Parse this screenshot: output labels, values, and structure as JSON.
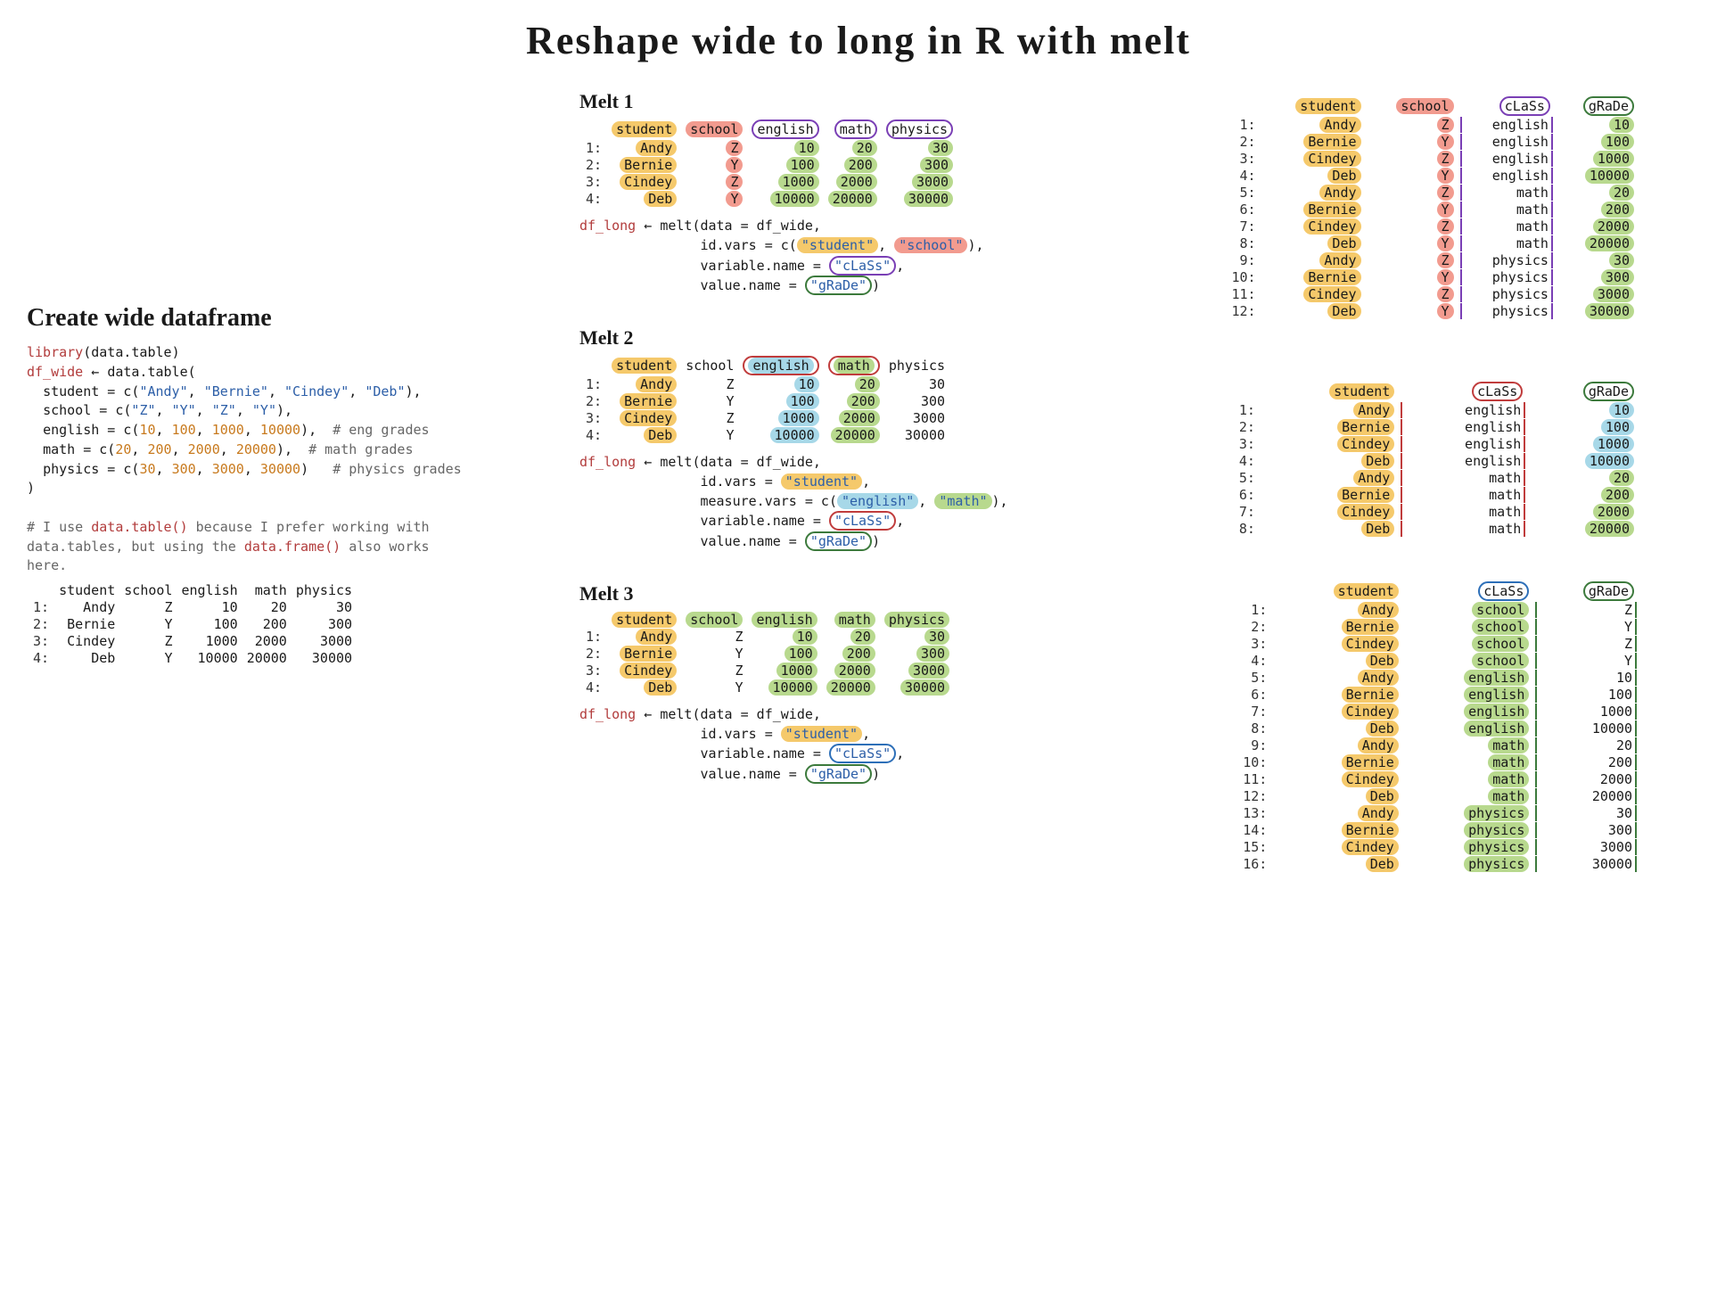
{
  "title": "Reshape wide to long in R with melt",
  "create": {
    "heading": "Create wide dataframe",
    "lib_call": "library",
    "lib_arg": "data.table",
    "df_var": "df_wide",
    "dt_fn": "data.table",
    "cols": {
      "student": "student",
      "school": "school",
      "english": "english",
      "math": "math",
      "physics": "physics"
    },
    "students": [
      "Andy",
      "Bernie",
      "Cindey",
      "Deb"
    ],
    "schools": [
      "Z",
      "Y",
      "Z",
      "Y"
    ],
    "english_vals": [
      10,
      100,
      1000,
      10000
    ],
    "math_vals": [
      20,
      200,
      2000,
      20000
    ],
    "physics_vals": [
      30,
      300,
      3000,
      30000
    ],
    "eng_comment": "# eng grades",
    "math_comment": "# math grades",
    "phys_comment": "# physics grades",
    "footnote_line1": "# I use",
    "footnote_dt": "data.table()",
    "footnote_line1b": " because I prefer working with",
    "footnote_line2": "data.tables, but using the ",
    "footnote_df": "data.frame()",
    "footnote_line2b": " also works",
    "footnote_line3": "here."
  },
  "melt1": {
    "heading": "Melt 1",
    "call_var": "df_long",
    "fn": "melt",
    "data_arg": "data = df_wide,",
    "id_vars_label": "id.vars = c(",
    "id_vars_v1": "\"student\"",
    "id_vars_v2": "\"school\"",
    "variable_name_label": "variable.name = ",
    "variable_name_val": "\"cLaSs\"",
    "value_name_label": "value.name = ",
    "value_name_val": "\"gRaDe\""
  },
  "melt2": {
    "heading": "Melt 2",
    "call_var": "df_long",
    "fn": "melt",
    "data_arg": "data = df_wide,",
    "id_vars_label": "id.vars = ",
    "id_vars_v1": "\"student\"",
    "measure_vars_label": "measure.vars = c(",
    "measure_v1": "\"english\"",
    "measure_v2": "\"math\"",
    "variable_name_label": "variable.name = ",
    "variable_name_val": "\"cLaSs\"",
    "value_name_label": "value.name = ",
    "value_name_val": "\"gRaDe\""
  },
  "melt3": {
    "heading": "Melt 3",
    "call_var": "df_long",
    "fn": "melt",
    "data_arg": "data = df_wide,",
    "id_vars_label": "id.vars = ",
    "id_vars_v1": "\"student\"",
    "variable_name_label": "variable.name = ",
    "variable_name_val": "\"cLaSs\"",
    "value_name_label": "value.name = ",
    "value_name_val": "\"gRaDe\""
  },
  "wide_header": [
    "student",
    "school",
    "english",
    "math",
    "physics"
  ],
  "wide_rows": [
    {
      "idx": "1:",
      "student": "Andy",
      "school": "Z",
      "english": 10,
      "math": 20,
      "physics": 30
    },
    {
      "idx": "2:",
      "student": "Bernie",
      "school": "Y",
      "english": 100,
      "math": 200,
      "physics": 300
    },
    {
      "idx": "3:",
      "student": "Cindey",
      "school": "Z",
      "english": 1000,
      "math": 2000,
      "physics": 3000
    },
    {
      "idx": "4:",
      "student": "Deb",
      "school": "Y",
      "english": 10000,
      "math": 20000,
      "physics": 30000
    }
  ],
  "result1_header": [
    "student",
    "school",
    "cLaSs",
    "gRaDe"
  ],
  "result1_rows": [
    {
      "idx": "1:",
      "student": "Andy",
      "school": "Z",
      "class": "english",
      "grade": 10
    },
    {
      "idx": "2:",
      "student": "Bernie",
      "school": "Y",
      "class": "english",
      "grade": 100
    },
    {
      "idx": "3:",
      "student": "Cindey",
      "school": "Z",
      "class": "english",
      "grade": 1000
    },
    {
      "idx": "4:",
      "student": "Deb",
      "school": "Y",
      "class": "english",
      "grade": 10000
    },
    {
      "idx": "5:",
      "student": "Andy",
      "school": "Z",
      "class": "math",
      "grade": 20
    },
    {
      "idx": "6:",
      "student": "Bernie",
      "school": "Y",
      "class": "math",
      "grade": 200
    },
    {
      "idx": "7:",
      "student": "Cindey",
      "school": "Z",
      "class": "math",
      "grade": 2000
    },
    {
      "idx": "8:",
      "student": "Deb",
      "school": "Y",
      "class": "math",
      "grade": 20000
    },
    {
      "idx": "9:",
      "student": "Andy",
      "school": "Z",
      "class": "physics",
      "grade": 30
    },
    {
      "idx": "10:",
      "student": "Bernie",
      "school": "Y",
      "class": "physics",
      "grade": 300
    },
    {
      "idx": "11:",
      "student": "Cindey",
      "school": "Z",
      "class": "physics",
      "grade": 3000
    },
    {
      "idx": "12:",
      "student": "Deb",
      "school": "Y",
      "class": "physics",
      "grade": 30000
    }
  ],
  "result2_header": [
    "student",
    "cLaSs",
    "gRaDe"
  ],
  "result2_rows": [
    {
      "idx": "1:",
      "student": "Andy",
      "class": "english",
      "grade": 10
    },
    {
      "idx": "2:",
      "student": "Bernie",
      "class": "english",
      "grade": 100
    },
    {
      "idx": "3:",
      "student": "Cindey",
      "class": "english",
      "grade": 1000
    },
    {
      "idx": "4:",
      "student": "Deb",
      "class": "english",
      "grade": 10000
    },
    {
      "idx": "5:",
      "student": "Andy",
      "class": "math",
      "grade": 20
    },
    {
      "idx": "6:",
      "student": "Bernie",
      "class": "math",
      "grade": 200
    },
    {
      "idx": "7:",
      "student": "Cindey",
      "class": "math",
      "grade": 2000
    },
    {
      "idx": "8:",
      "student": "Deb",
      "class": "math",
      "grade": 20000
    }
  ],
  "result3_header": [
    "student",
    "cLaSs",
    "gRaDe"
  ],
  "result3_rows": [
    {
      "idx": "1:",
      "student": "Andy",
      "class": "school",
      "grade": "Z"
    },
    {
      "idx": "2:",
      "student": "Bernie",
      "class": "school",
      "grade": "Y"
    },
    {
      "idx": "3:",
      "student": "Cindey",
      "class": "school",
      "grade": "Z"
    },
    {
      "idx": "4:",
      "student": "Deb",
      "class": "school",
      "grade": "Y"
    },
    {
      "idx": "5:",
      "student": "Andy",
      "class": "english",
      "grade": 10
    },
    {
      "idx": "6:",
      "student": "Bernie",
      "class": "english",
      "grade": 100
    },
    {
      "idx": "7:",
      "student": "Cindey",
      "class": "english",
      "grade": 1000
    },
    {
      "idx": "8:",
      "student": "Deb",
      "class": "english",
      "grade": 10000
    },
    {
      "idx": "9:",
      "student": "Andy",
      "class": "math",
      "grade": 20
    },
    {
      "idx": "10:",
      "student": "Bernie",
      "class": "math",
      "grade": 200
    },
    {
      "idx": "11:",
      "student": "Cindey",
      "class": "math",
      "grade": 2000
    },
    {
      "idx": "12:",
      "student": "Deb",
      "class": "math",
      "grade": 20000
    },
    {
      "idx": "13:",
      "student": "Andy",
      "class": "physics",
      "grade": 30
    },
    {
      "idx": "14:",
      "student": "Bernie",
      "class": "physics",
      "grade": 300
    },
    {
      "idx": "15:",
      "student": "Cindey",
      "class": "physics",
      "grade": 3000
    },
    {
      "idx": "16:",
      "student": "Deb",
      "class": "physics",
      "grade": 30000
    }
  ]
}
